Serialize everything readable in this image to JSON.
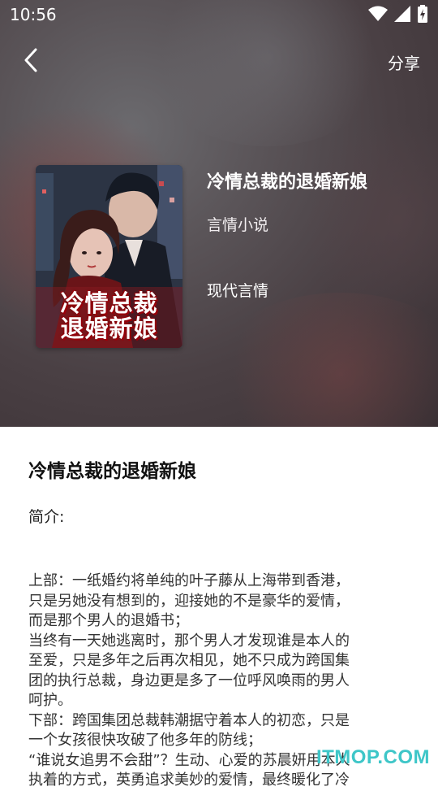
{
  "status_bar": {
    "time": "10:56",
    "icons": [
      "wifi-icon",
      "signal-icon",
      "battery-charging-icon"
    ]
  },
  "nav": {
    "back_icon": "chevron-left-icon",
    "share_label": "分享"
  },
  "book": {
    "title": "冷情总裁的退婚新娘",
    "category": "言情小说",
    "tag": "现代言情",
    "cover_title_line1": "冷情总裁",
    "cover_title_line2": "退婚新娘"
  },
  "detail": {
    "title": "冷情总裁的退婚新娘",
    "intro_label": "简介:",
    "intro_text": "上部：一纸婚约将单纯的叶子藤从上海带到香港，\n只是另她没有想到的，迎接她的不是豪华的爱情，\n而是那个男人的退婚书；\n当终有一天她逃离时，那个男人才发现谁是本人的\n至爱，只是多年之后再次相见，她不只成为跨国集\n团的执行总裁，身边更是多了一位呼风唤雨的男人\n呵护。\n下部：跨国集团总裁韩潮据守着本人的初恋，只是\n一个女孩很快攻破了他多年的防线；\n“谁说女追男不会甜”？生动、心爱的苏晨妍用本人\n执着的方式，英勇追求美妙的爱情，最终暖化了冷"
  },
  "watermark": "ITMOP.COM",
  "colors": {
    "hero_text": "#ffffff",
    "watermark": "#3ec6c8",
    "cover_title_stroke": "#a0000a"
  }
}
